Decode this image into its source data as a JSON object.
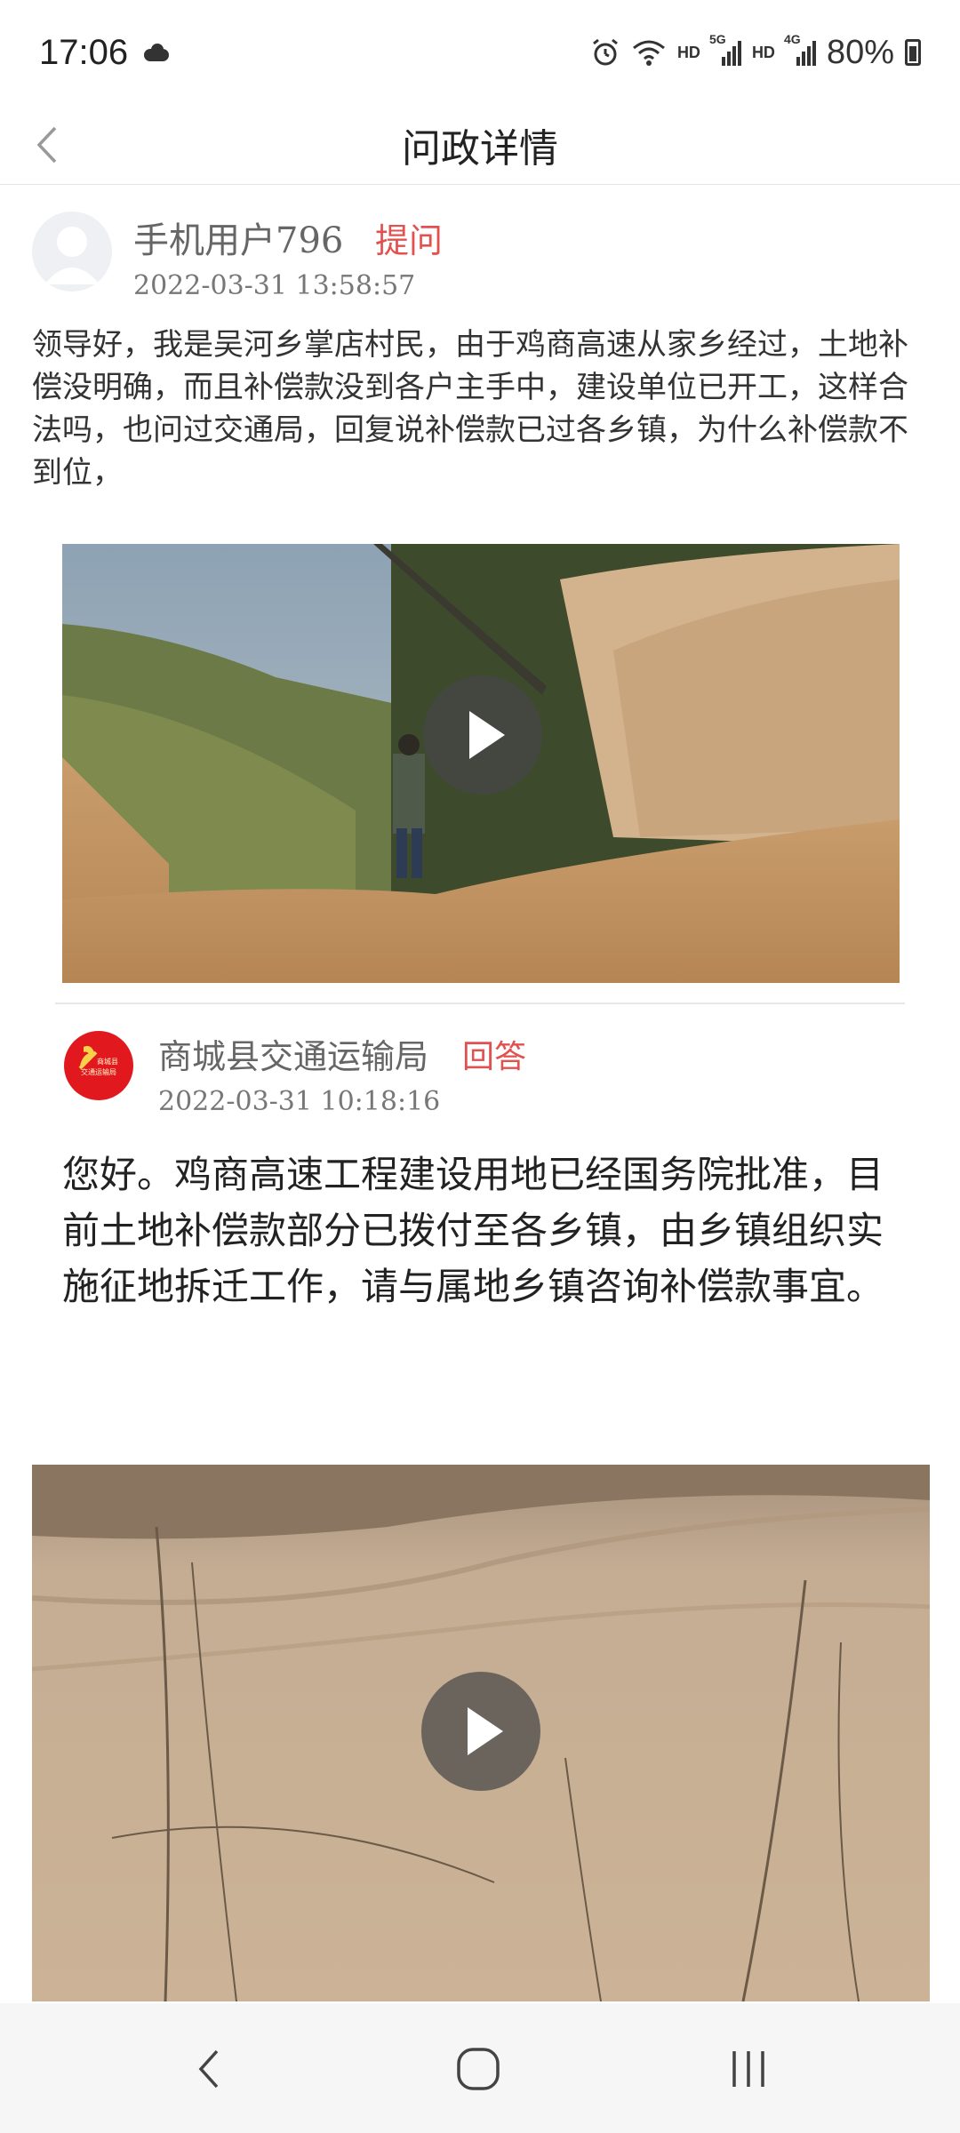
{
  "status_bar": {
    "time": "17:06",
    "hd1": "HD",
    "net1": "5G",
    "hd2": "HD",
    "net2": "4G",
    "battery": "80%"
  },
  "header": {
    "title": "问政详情"
  },
  "question": {
    "user_name": "手机用户796",
    "tag": "提问",
    "time": "2022-03-31 13:58:57",
    "text": "领导好，我是吴河乡掌店村民，由于鸡商高速从家乡经过，土地补偿没明确，而且补偿款没到各户主手中，建设单位已开工，这样合法吗，也问过交通局，回复说补偿款已过各乡镇，为什么补偿款不到位，"
  },
  "answer": {
    "org_name": "商城县交通运输局",
    "tag": "回答",
    "time": "2022-03-31 10:18:16",
    "logo_text": [
      "商城县",
      "交通运输局"
    ],
    "text": "您好。鸡商高速工程建设用地已经国务院批准，目前土地补偿款部分已拨付至各乡镇，由乡镇组织实施征地拆迁工作，请与属地乡镇咨询补偿款事宜。"
  },
  "icons": {
    "back": "chevron-left-icon",
    "play": "play-icon",
    "alarm": "alarm-icon",
    "wifi": "wifi-icon",
    "signal": "signal-icon",
    "battery": "battery-icon",
    "nav_back": "nav-back-icon",
    "nav_home": "nav-home-icon",
    "nav_recents": "nav-recents-icon"
  },
  "colors": {
    "accent_red": "#e0514f",
    "logo_red": "#e1191e"
  }
}
